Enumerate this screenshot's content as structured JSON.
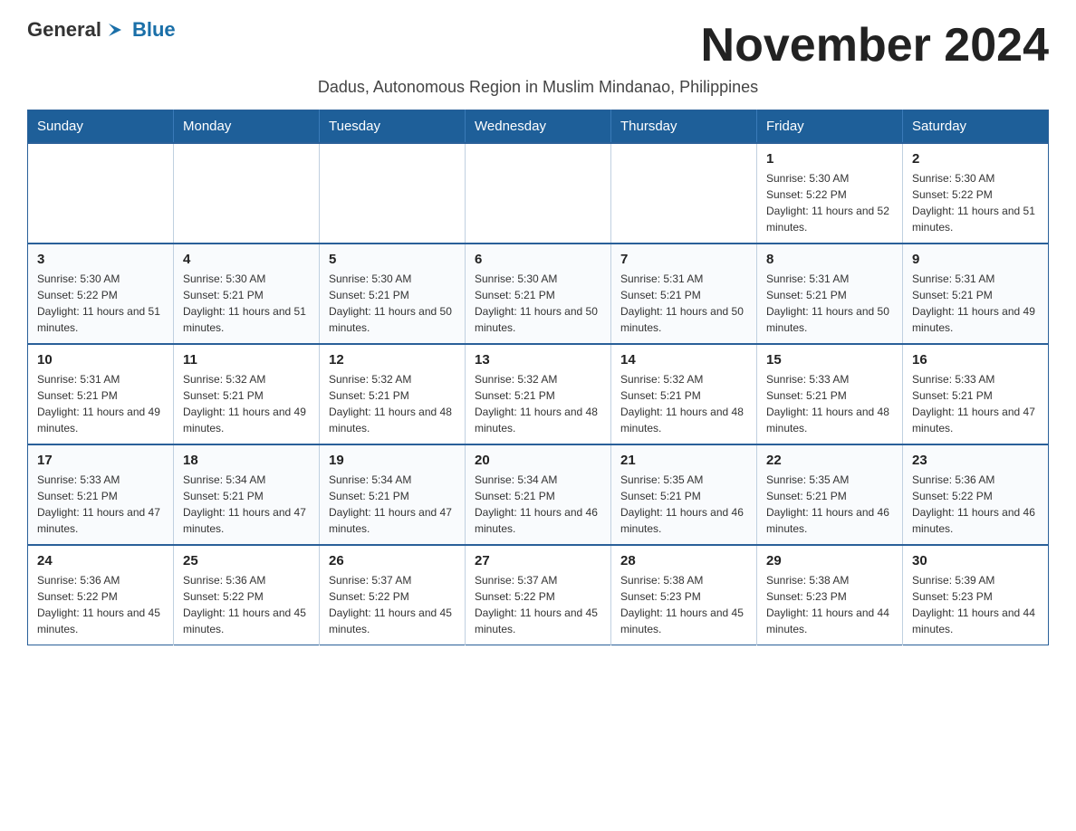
{
  "logo": {
    "text_general": "General",
    "text_blue": "Blue",
    "arrow_color": "#1a6fa8"
  },
  "title": "November 2024",
  "subtitle": "Dadus, Autonomous Region in Muslim Mindanao, Philippines",
  "days_of_week": [
    "Sunday",
    "Monday",
    "Tuesday",
    "Wednesday",
    "Thursday",
    "Friday",
    "Saturday"
  ],
  "weeks": [
    [
      {
        "day": "",
        "sunrise": "",
        "sunset": "",
        "daylight": ""
      },
      {
        "day": "",
        "sunrise": "",
        "sunset": "",
        "daylight": ""
      },
      {
        "day": "",
        "sunrise": "",
        "sunset": "",
        "daylight": ""
      },
      {
        "day": "",
        "sunrise": "",
        "sunset": "",
        "daylight": ""
      },
      {
        "day": "",
        "sunrise": "",
        "sunset": "",
        "daylight": ""
      },
      {
        "day": "1",
        "sunrise": "Sunrise: 5:30 AM",
        "sunset": "Sunset: 5:22 PM",
        "daylight": "Daylight: 11 hours and 52 minutes."
      },
      {
        "day": "2",
        "sunrise": "Sunrise: 5:30 AM",
        "sunset": "Sunset: 5:22 PM",
        "daylight": "Daylight: 11 hours and 51 minutes."
      }
    ],
    [
      {
        "day": "3",
        "sunrise": "Sunrise: 5:30 AM",
        "sunset": "Sunset: 5:22 PM",
        "daylight": "Daylight: 11 hours and 51 minutes."
      },
      {
        "day": "4",
        "sunrise": "Sunrise: 5:30 AM",
        "sunset": "Sunset: 5:21 PM",
        "daylight": "Daylight: 11 hours and 51 minutes."
      },
      {
        "day": "5",
        "sunrise": "Sunrise: 5:30 AM",
        "sunset": "Sunset: 5:21 PM",
        "daylight": "Daylight: 11 hours and 50 minutes."
      },
      {
        "day": "6",
        "sunrise": "Sunrise: 5:30 AM",
        "sunset": "Sunset: 5:21 PM",
        "daylight": "Daylight: 11 hours and 50 minutes."
      },
      {
        "day": "7",
        "sunrise": "Sunrise: 5:31 AM",
        "sunset": "Sunset: 5:21 PM",
        "daylight": "Daylight: 11 hours and 50 minutes."
      },
      {
        "day": "8",
        "sunrise": "Sunrise: 5:31 AM",
        "sunset": "Sunset: 5:21 PM",
        "daylight": "Daylight: 11 hours and 50 minutes."
      },
      {
        "day": "9",
        "sunrise": "Sunrise: 5:31 AM",
        "sunset": "Sunset: 5:21 PM",
        "daylight": "Daylight: 11 hours and 49 minutes."
      }
    ],
    [
      {
        "day": "10",
        "sunrise": "Sunrise: 5:31 AM",
        "sunset": "Sunset: 5:21 PM",
        "daylight": "Daylight: 11 hours and 49 minutes."
      },
      {
        "day": "11",
        "sunrise": "Sunrise: 5:32 AM",
        "sunset": "Sunset: 5:21 PM",
        "daylight": "Daylight: 11 hours and 49 minutes."
      },
      {
        "day": "12",
        "sunrise": "Sunrise: 5:32 AM",
        "sunset": "Sunset: 5:21 PM",
        "daylight": "Daylight: 11 hours and 48 minutes."
      },
      {
        "day": "13",
        "sunrise": "Sunrise: 5:32 AM",
        "sunset": "Sunset: 5:21 PM",
        "daylight": "Daylight: 11 hours and 48 minutes."
      },
      {
        "day": "14",
        "sunrise": "Sunrise: 5:32 AM",
        "sunset": "Sunset: 5:21 PM",
        "daylight": "Daylight: 11 hours and 48 minutes."
      },
      {
        "day": "15",
        "sunrise": "Sunrise: 5:33 AM",
        "sunset": "Sunset: 5:21 PM",
        "daylight": "Daylight: 11 hours and 48 minutes."
      },
      {
        "day": "16",
        "sunrise": "Sunrise: 5:33 AM",
        "sunset": "Sunset: 5:21 PM",
        "daylight": "Daylight: 11 hours and 47 minutes."
      }
    ],
    [
      {
        "day": "17",
        "sunrise": "Sunrise: 5:33 AM",
        "sunset": "Sunset: 5:21 PM",
        "daylight": "Daylight: 11 hours and 47 minutes."
      },
      {
        "day": "18",
        "sunrise": "Sunrise: 5:34 AM",
        "sunset": "Sunset: 5:21 PM",
        "daylight": "Daylight: 11 hours and 47 minutes."
      },
      {
        "day": "19",
        "sunrise": "Sunrise: 5:34 AM",
        "sunset": "Sunset: 5:21 PM",
        "daylight": "Daylight: 11 hours and 47 minutes."
      },
      {
        "day": "20",
        "sunrise": "Sunrise: 5:34 AM",
        "sunset": "Sunset: 5:21 PM",
        "daylight": "Daylight: 11 hours and 46 minutes."
      },
      {
        "day": "21",
        "sunrise": "Sunrise: 5:35 AM",
        "sunset": "Sunset: 5:21 PM",
        "daylight": "Daylight: 11 hours and 46 minutes."
      },
      {
        "day": "22",
        "sunrise": "Sunrise: 5:35 AM",
        "sunset": "Sunset: 5:21 PM",
        "daylight": "Daylight: 11 hours and 46 minutes."
      },
      {
        "day": "23",
        "sunrise": "Sunrise: 5:36 AM",
        "sunset": "Sunset: 5:22 PM",
        "daylight": "Daylight: 11 hours and 46 minutes."
      }
    ],
    [
      {
        "day": "24",
        "sunrise": "Sunrise: 5:36 AM",
        "sunset": "Sunset: 5:22 PM",
        "daylight": "Daylight: 11 hours and 45 minutes."
      },
      {
        "day": "25",
        "sunrise": "Sunrise: 5:36 AM",
        "sunset": "Sunset: 5:22 PM",
        "daylight": "Daylight: 11 hours and 45 minutes."
      },
      {
        "day": "26",
        "sunrise": "Sunrise: 5:37 AM",
        "sunset": "Sunset: 5:22 PM",
        "daylight": "Daylight: 11 hours and 45 minutes."
      },
      {
        "day": "27",
        "sunrise": "Sunrise: 5:37 AM",
        "sunset": "Sunset: 5:22 PM",
        "daylight": "Daylight: 11 hours and 45 minutes."
      },
      {
        "day": "28",
        "sunrise": "Sunrise: 5:38 AM",
        "sunset": "Sunset: 5:23 PM",
        "daylight": "Daylight: 11 hours and 45 minutes."
      },
      {
        "day": "29",
        "sunrise": "Sunrise: 5:38 AM",
        "sunset": "Sunset: 5:23 PM",
        "daylight": "Daylight: 11 hours and 44 minutes."
      },
      {
        "day": "30",
        "sunrise": "Sunrise: 5:39 AM",
        "sunset": "Sunset: 5:23 PM",
        "daylight": "Daylight: 11 hours and 44 minutes."
      }
    ]
  ]
}
